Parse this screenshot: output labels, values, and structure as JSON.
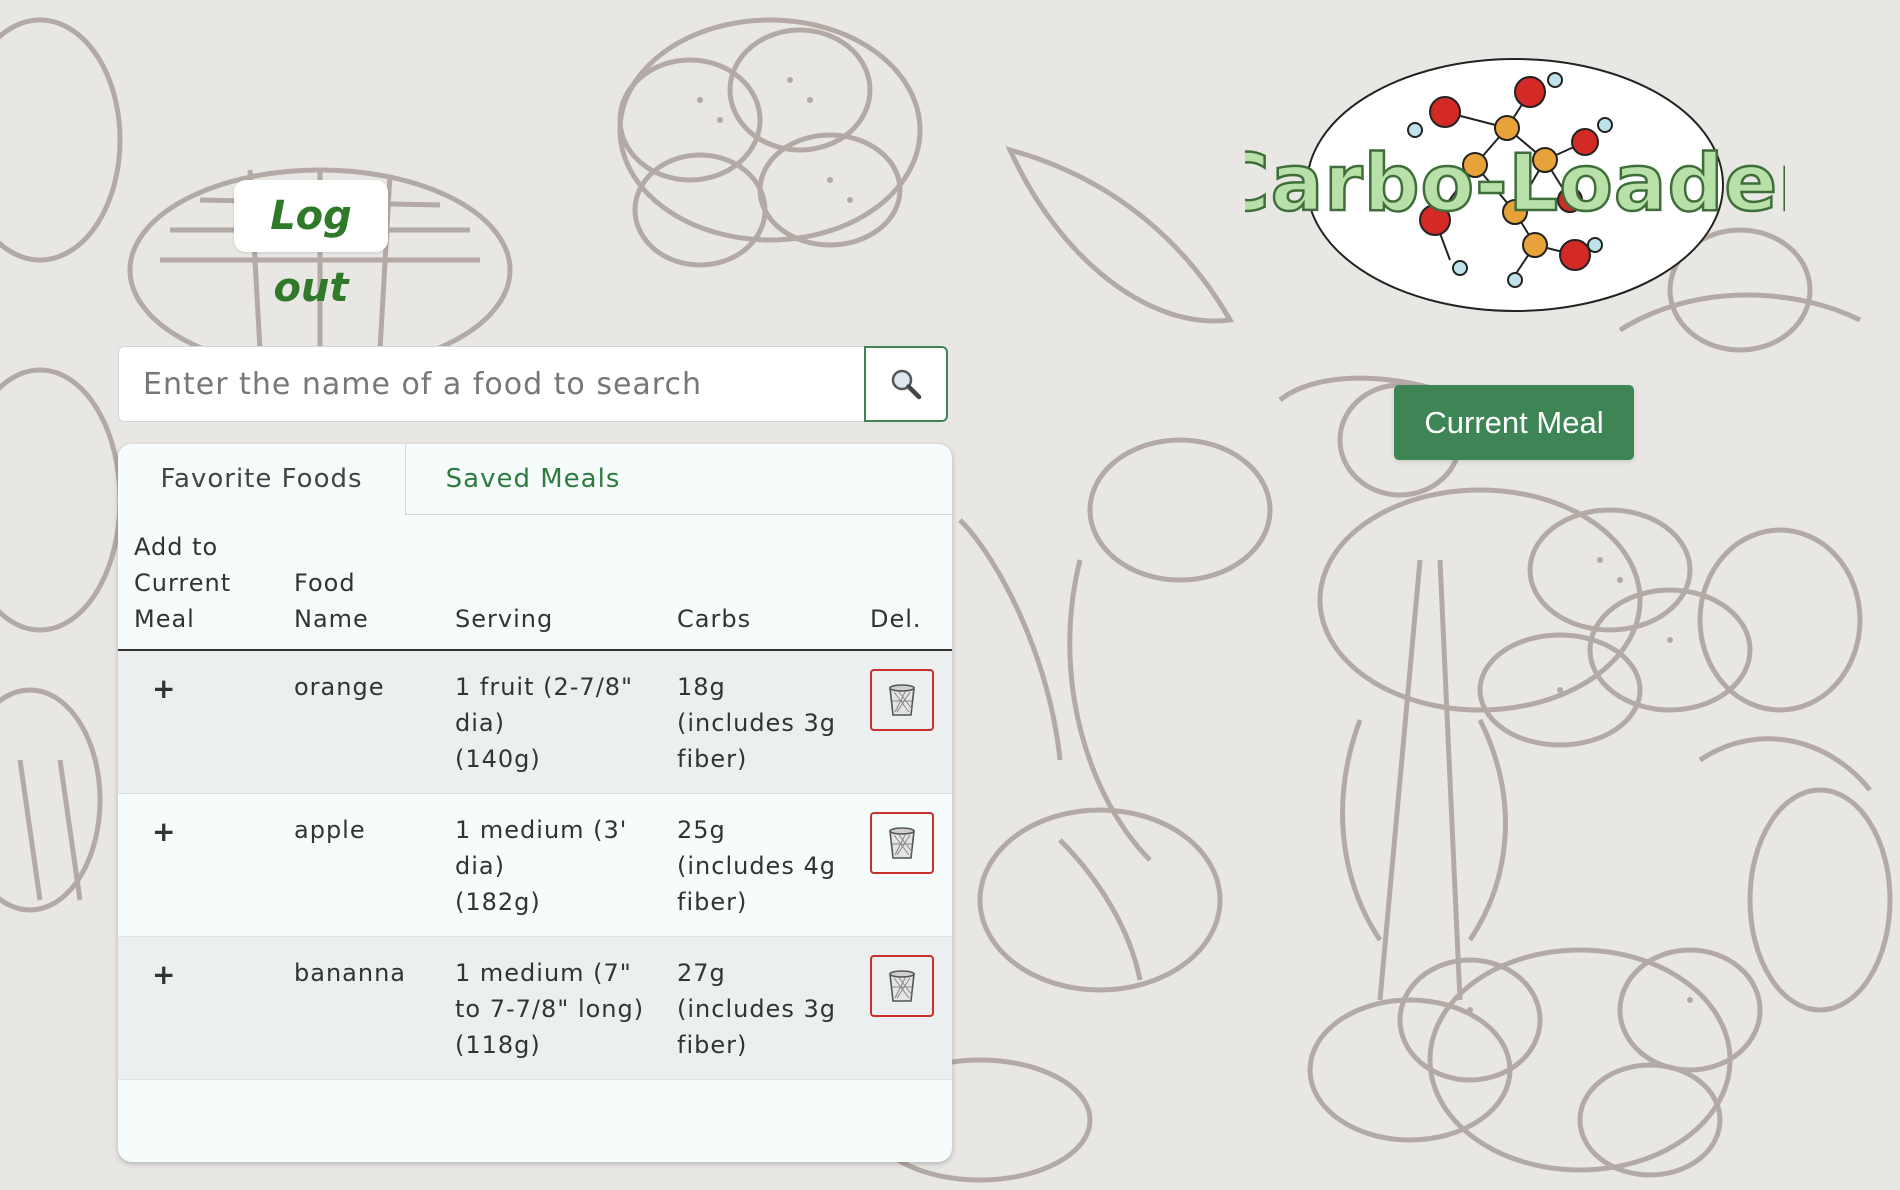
{
  "header": {
    "logout_label": "Log out",
    "logo_text": "Carbo-Loader",
    "current_meal_label": "Current Meal"
  },
  "search": {
    "placeholder": "Enter the name of a food to search",
    "value": "",
    "button_icon": "search-icon"
  },
  "tabs": [
    {
      "label": "Favorite Foods",
      "active": true
    },
    {
      "label": "Saved Meals",
      "active": false
    }
  ],
  "table": {
    "headers": {
      "add": [
        "Add to",
        "Current",
        "Meal"
      ],
      "name": [
        "Food",
        "Name"
      ],
      "serving": "Serving",
      "carbs": "Carbs",
      "delete": "Del."
    },
    "rows": [
      {
        "add": "+",
        "name": "orange",
        "serving": [
          "1 fruit (2-7/8\"",
          "dia)",
          "(140g)"
        ],
        "carbs": [
          "18g",
          "(includes 3g",
          "fiber)"
        ],
        "delete_icon": "trash-icon"
      },
      {
        "add": "+",
        "name": "apple",
        "serving": [
          "1 medium (3'",
          "dia)",
          "(182g)"
        ],
        "carbs": [
          "25g",
          "(includes 4g",
          "fiber)"
        ],
        "delete_icon": "trash-icon"
      },
      {
        "add": "+",
        "name": "bananna",
        "serving": [
          "1 medium (7\"",
          "to 7-7/8\" long)",
          "(118g)"
        ],
        "carbs": [
          "27g",
          "(includes 3g",
          "fiber)"
        ],
        "delete_icon": "trash-icon"
      }
    ]
  },
  "colors": {
    "brand_green": "#3e8556",
    "logout_text": "#2f7a29",
    "delete_red": "#c9302c",
    "background": "#e9e7e4"
  }
}
